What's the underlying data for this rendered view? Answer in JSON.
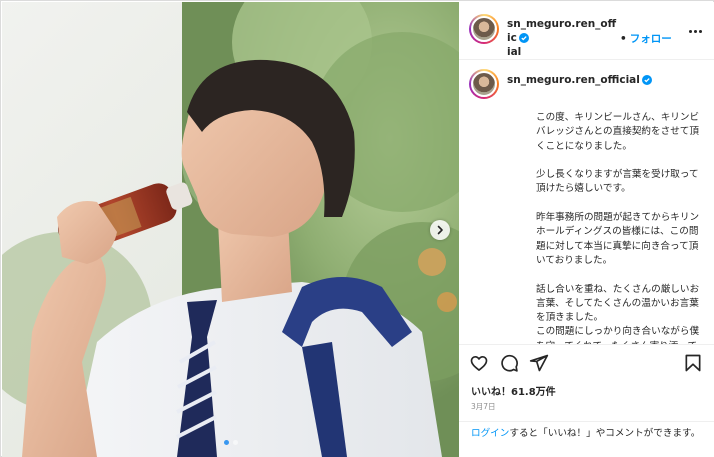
{
  "post": {
    "username": "sn_meguro.ren_official",
    "username_wrapped_line1": "sn_meguro.ren_offic",
    "username_wrapped_line2": "ial",
    "follow_separator": "•",
    "follow_label": "フォロー",
    "verified_icon": "verified-badge-icon",
    "more_icon": "more-options-icon"
  },
  "caption": {
    "paragraphs": [
      "この度、キリンビールさん、キリンビバレッジさんとの直接契約をさせて頂くことになりました。",
      "少し長くなりますが言葉を受け取って頂けたら嬉しいです。",
      "昨年事務所の問題が起きてからキリンホールディングスの皆様には、この問題に対して本当に真摯に向き合って頂いておりました。",
      "話し合いを重ね、たくさんの厳しいお言葉、そしてたくさんの温かいお言葉を頂きました。",
      "この問題にしっかり向き合いながら僕を守ってくれて、たくさん寄り添って"
    ]
  },
  "actions": {
    "like_icon": "heart-icon",
    "comment_icon": "comment-icon",
    "share_icon": "share-icon",
    "save_icon": "bookmark-icon",
    "likes_text": "いいね！61.8万件",
    "date_text": "3月7日"
  },
  "login_prompt": {
    "link_text": "ログイン",
    "rest_text": "すると「いいね！」やコメントができます。"
  },
  "carousel": {
    "slide_count": 2,
    "active_index": 0,
    "next_icon": "chevron-right-icon"
  },
  "colors": {
    "accent_blue": "#0095f6",
    "verified_blue": "#0095f6",
    "text": "#262626",
    "muted": "#8e8e8e"
  }
}
